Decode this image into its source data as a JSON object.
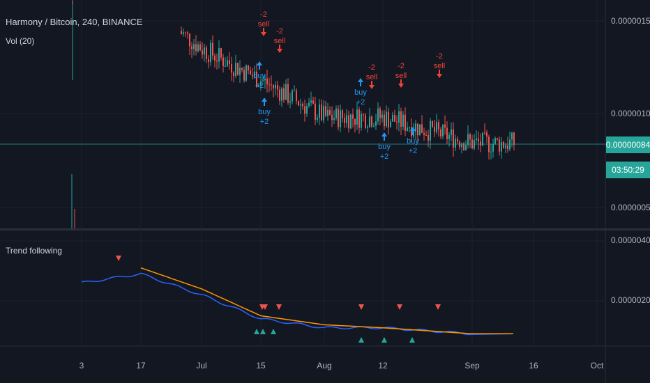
{
  "symbol_legend": "Harmony / Bitcoin, 240, BINANCE",
  "volume_legend": "Vol (20)",
  "indicator_legend": "Trend following",
  "current_price_label": "0.00000084",
  "countdown_label": "03:50:29",
  "colors": {
    "background": "#131722",
    "grid": "#1e222d",
    "up": "#26a69a",
    "down": "#ef5350",
    "price_line": "#26a69a",
    "buy_signal": "#2196f3",
    "sell_signal": "#f44336",
    "trend_fast": "#2962ff",
    "trend_slow": "#ff9800",
    "triangle_up": "#26a69a",
    "triangle_down": "#ef5350",
    "axis_text": "#b2b5be"
  },
  "chart_data": [
    {
      "type": "candlestick",
      "title": "Harmony / Bitcoin, 240, BINANCE",
      "x_ticks": [
        "3",
        "17",
        "Jul",
        "15",
        "Aug",
        "12",
        "Sep",
        "16",
        "Oct"
      ],
      "y_ticks": [
        "0.00000150",
        "0.00000100",
        "0.00000050"
      ],
      "ylim": [
        3e-07,
        1.7e-06
      ],
      "current_price": 8.4e-07,
      "close_path": [
        [
          "3",
          1.6e-06
        ],
        [
          "17",
          1.6e-06
        ],
        [
          "Jul",
          1.35e-06
        ],
        [
          "15",
          1.18e-06
        ],
        [
          "Aug",
          9.8e-07
        ],
        [
          "12",
          9.8e-07
        ],
        [
          "Sep",
          8.4e-07
        ]
      ],
      "signals": [
        {
          "x": "15",
          "kind": "buy",
          "label": "buy",
          "value": "+2"
        },
        {
          "x": "15",
          "kind": "sell",
          "label": "sell",
          "value": "-2"
        },
        {
          "x": "15",
          "kind": "buy",
          "label": "buy",
          "value": "+2"
        },
        {
          "x": "15",
          "kind": "sell",
          "label": "sell",
          "value": "-2"
        },
        {
          "x": "Aug",
          "kind": "buy",
          "label": "buy",
          "value": "+2"
        },
        {
          "x": "Aug",
          "kind": "sell",
          "label": "sell",
          "value": "-2"
        },
        {
          "x": "12",
          "kind": "buy",
          "label": "buy",
          "value": "+2"
        },
        {
          "x": "12",
          "kind": "sell",
          "label": "sell",
          "value": "-2"
        },
        {
          "x": "12",
          "kind": "buy",
          "label": "buy",
          "value": "+2"
        },
        {
          "x": "12",
          "kind": "sell",
          "label": "sell",
          "value": "-2"
        }
      ]
    },
    {
      "type": "bar",
      "title": "Vol (20)",
      "note": "volume bars at bottom of price pane"
    },
    {
      "type": "line",
      "title": "Trend following",
      "y_ticks": [
        "0.00000400",
        "0.00000200"
      ],
      "series": [
        {
          "role": "fast",
          "points": [
            [
              "3",
              2.6e-06
            ],
            [
              "17",
              2.9e-06
            ],
            [
              "Jul",
              2.2e-06
            ],
            [
              "15",
              1.4e-06
            ],
            [
              "Aug",
              1.1e-06
            ],
            [
              "12",
              1.1e-06
            ],
            [
              "Sep",
              9e-07
            ]
          ]
        },
        {
          "role": "slow",
          "points": [
            [
              "17",
              3.1e-06
            ],
            [
              "Jul",
              2.4e-06
            ],
            [
              "15",
              1.5e-06
            ],
            [
              "Aug",
              1.2e-06
            ],
            [
              "12",
              1.1e-06
            ],
            [
              "Sep",
              9e-07
            ]
          ]
        }
      ],
      "markers": [
        {
          "x": "17",
          "kind": "down"
        },
        {
          "x": "15",
          "kind": "down"
        },
        {
          "x": "15",
          "kind": "down"
        },
        {
          "x": "15",
          "kind": "down"
        },
        {
          "x": "15",
          "kind": "up"
        },
        {
          "x": "15",
          "kind": "up"
        },
        {
          "x": "15",
          "kind": "up"
        },
        {
          "x": "Aug",
          "kind": "down"
        },
        {
          "x": "Aug",
          "kind": "up"
        },
        {
          "x": "12",
          "kind": "up"
        },
        {
          "x": "12",
          "kind": "down"
        },
        {
          "x": "12",
          "kind": "up"
        },
        {
          "x": "Sep",
          "kind": "down"
        }
      ]
    }
  ]
}
